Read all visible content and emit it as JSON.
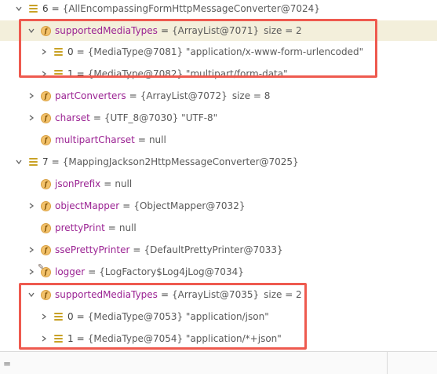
{
  "tree": {
    "row0": {
      "index": "6",
      "eq": "=",
      "value": "{AllEncompassingFormHttpMessageConverter@7024}"
    },
    "row1": {
      "name": "supportedMediaTypes",
      "eq": "=",
      "value": "{ArrayList@7071}",
      "size": "size = 2"
    },
    "row2": {
      "index": "0",
      "eq": "=",
      "value": "{MediaType@7081} \"application/x-www-form-urlencoded\""
    },
    "row3": {
      "index": "1",
      "eq": "=",
      "value": "{MediaType@7082} \"multipart/form-data\""
    },
    "row4": {
      "name": "partConverters",
      "eq": "=",
      "value": "{ArrayList@7072}",
      "size": "size = 8"
    },
    "row5": {
      "name": "charset",
      "eq": "=",
      "value": "{UTF_8@7030} \"UTF-8\""
    },
    "row6": {
      "name": "multipartCharset",
      "eq": "=",
      "value": "null"
    },
    "row7": {
      "index": "7",
      "eq": "=",
      "value": "{MappingJackson2HttpMessageConverter@7025}"
    },
    "row8": {
      "name": "jsonPrefix",
      "eq": "=",
      "value": "null"
    },
    "row9": {
      "name": "objectMapper",
      "eq": "=",
      "value": "{ObjectMapper@7032}"
    },
    "row10": {
      "name": "prettyPrint",
      "eq": "=",
      "value": "null"
    },
    "row11": {
      "name": "ssePrettyPrinter",
      "eq": "=",
      "value": "{DefaultPrettyPrinter@7033}"
    },
    "row12": {
      "name": "logger",
      "eq": "=",
      "value": "{LogFactory$Log4jLog@7034}"
    },
    "row13": {
      "name": "supportedMediaTypes",
      "eq": "=",
      "value": "{ArrayList@7035}",
      "size": "size = 2"
    },
    "row14": {
      "index": "0",
      "eq": "=",
      "value": "{MediaType@7053} \"application/json\""
    },
    "row15": {
      "index": "1",
      "eq": "=",
      "value": "{MediaType@7054} \"application/*+json\""
    }
  },
  "icons": {
    "field": "field-icon",
    "list": "list-icon",
    "field_letter": "f"
  },
  "bottom": {
    "text": "="
  },
  "colors": {
    "highlight_box": "#ee5a4f",
    "field_name": "#9b2393",
    "selected_row": "#f3efdb",
    "field_icon": "#f3c26b",
    "list_icon": "#c9a227"
  }
}
